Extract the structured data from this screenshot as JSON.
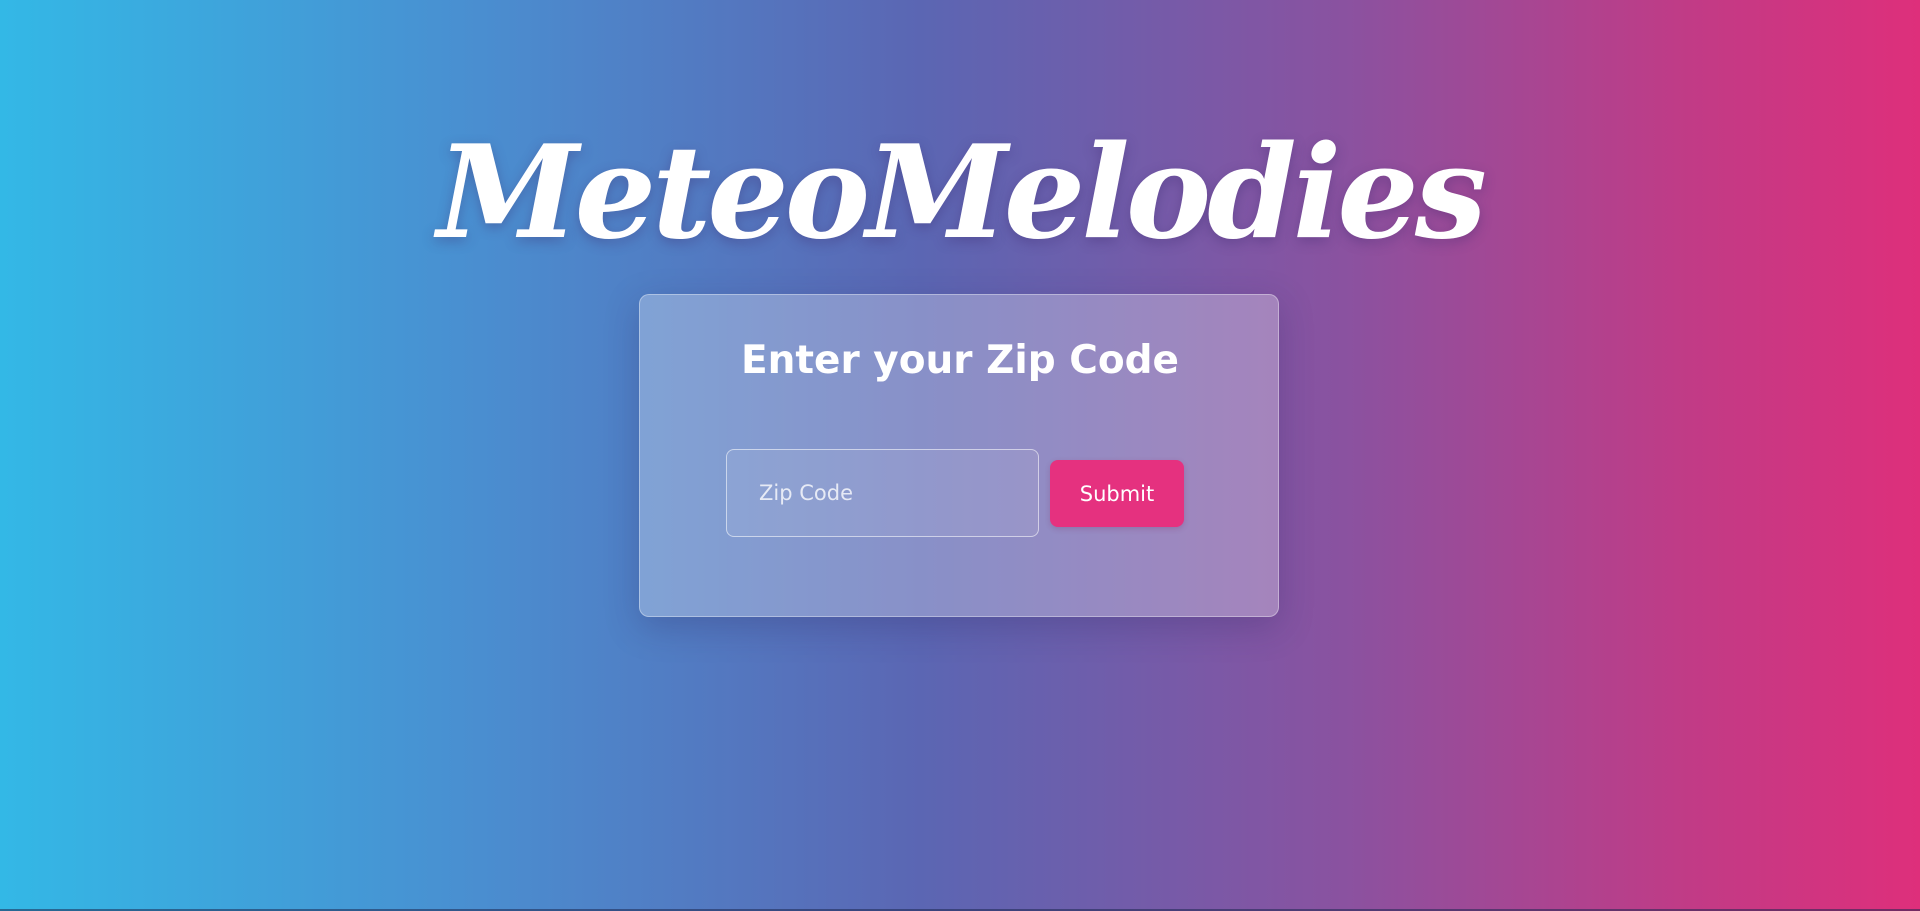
{
  "app": {
    "title": "MeteoMelodies"
  },
  "card": {
    "heading": "Enter your Zip Code",
    "zip_input": {
      "value": "",
      "placeholder": "Zip Code"
    },
    "submit_label": "Submit"
  },
  "colors": {
    "gradient_start": "#33b8e6",
    "gradient_mid": "#5b66b3",
    "gradient_end": "#de2f7b",
    "submit_button": "#e5317f",
    "text": "#ffffff"
  }
}
